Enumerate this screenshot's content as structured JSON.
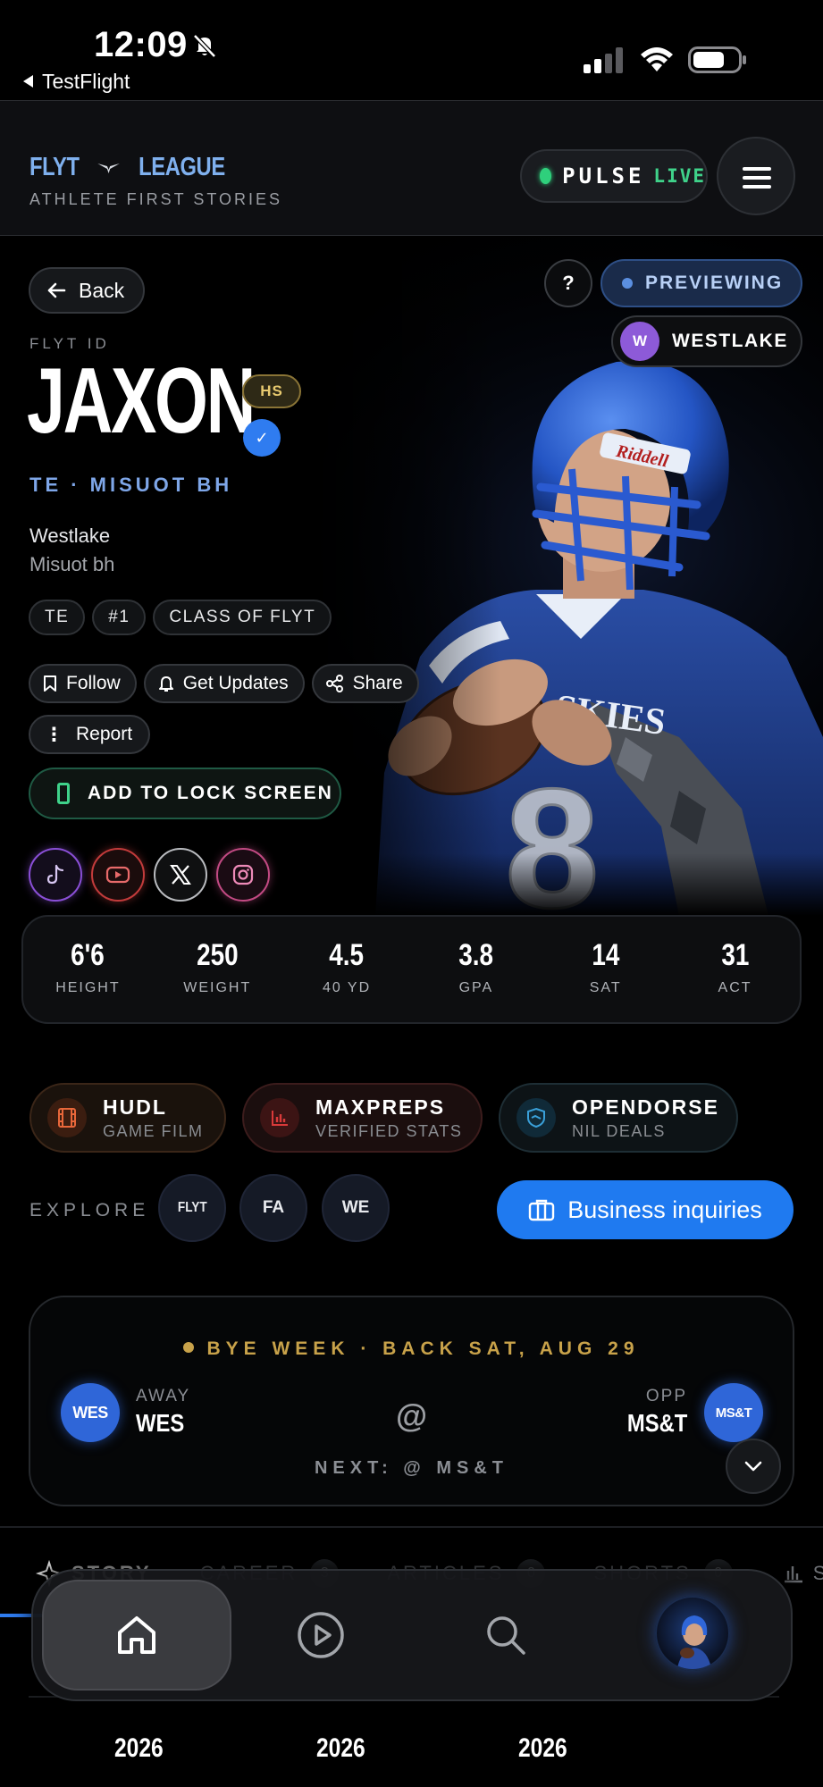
{
  "status_bar": {
    "time": "12:09",
    "back_app": "TestFlight"
  },
  "header": {
    "logo_left": "FLYT",
    "logo_right": "LEAGUE",
    "tagline": "ATHLETE FIRST STORIES",
    "pulse": "PULSE",
    "live": "LIVE",
    "colors": {
      "accent": "#7fb0ee",
      "live_green": "#3fd28a"
    }
  },
  "hero": {
    "back_label": "Back",
    "help_label": "?",
    "previewing_label": "PREVIEWING",
    "school_initial": "W",
    "school_pill": "WESTLAKE",
    "flyt_id_label": "FLYT ID",
    "name": "JAXON",
    "level_badge": "HS",
    "verified_icon": "✓",
    "position_line": "TE · MISUOT BH",
    "school": "Westlake",
    "city": "Misuot bh",
    "tags": [
      "TE",
      "#1",
      "CLASS OF FLYT"
    ],
    "actions": {
      "follow": "Follow",
      "get_updates": "Get Updates",
      "share": "Share",
      "report": "Report",
      "lock_screen": "ADD TO LOCK SCREEN"
    },
    "socials": [
      "tiktok-icon",
      "youtube-icon",
      "x-icon",
      "instagram-icon"
    ],
    "jersey_number": "8",
    "jersey_text": "SKIES",
    "helmet_brand": "Riddell"
  },
  "stats": [
    {
      "value": "6'6",
      "label": "HEIGHT"
    },
    {
      "value": "250",
      "label": "WEIGHT"
    },
    {
      "value": "4.5",
      "label": "40 YD"
    },
    {
      "value": "3.8",
      "label": "GPA"
    },
    {
      "value": "14",
      "label": "SAT"
    },
    {
      "value": "31",
      "label": "ACT"
    }
  ],
  "partners": [
    {
      "title": "HUDL",
      "subtitle": "GAME FILM",
      "color": "#e8673a"
    },
    {
      "title": "MAXPREPS",
      "subtitle": "VERIFIED STATS",
      "color": "#d93a3a"
    },
    {
      "title": "OPENDORSE",
      "subtitle": "NIL DEALS",
      "color": "#3aa0d9"
    }
  ],
  "explore": {
    "label": "EXPLORE",
    "chips": [
      "FLYT",
      "FA",
      "WE"
    ],
    "business_label": "Business inquiries"
  },
  "game": {
    "status": "BYE WEEK · BACK SAT, AUG 29",
    "away_label": "AWAY",
    "away_team": "WES",
    "away_badge": "WES",
    "at_symbol": "@",
    "opp_label": "OPP",
    "opp_team": "MS&T",
    "opp_badge": "MS&T",
    "next": "NEXT: @ MS&T"
  },
  "tabs": [
    {
      "label": "STORY",
      "count": ""
    },
    {
      "label": "CAREER",
      "count": "3"
    },
    {
      "label": "ARTICLES",
      "count": "0"
    },
    {
      "label": "SHORTS",
      "count": "0"
    },
    {
      "label": "ST",
      "count": ""
    }
  ],
  "bottom_nav": [
    "home-icon",
    "play-icon",
    "search-icon",
    "profile-avatar"
  ],
  "years": [
    "2026",
    "2026",
    "2026"
  ]
}
